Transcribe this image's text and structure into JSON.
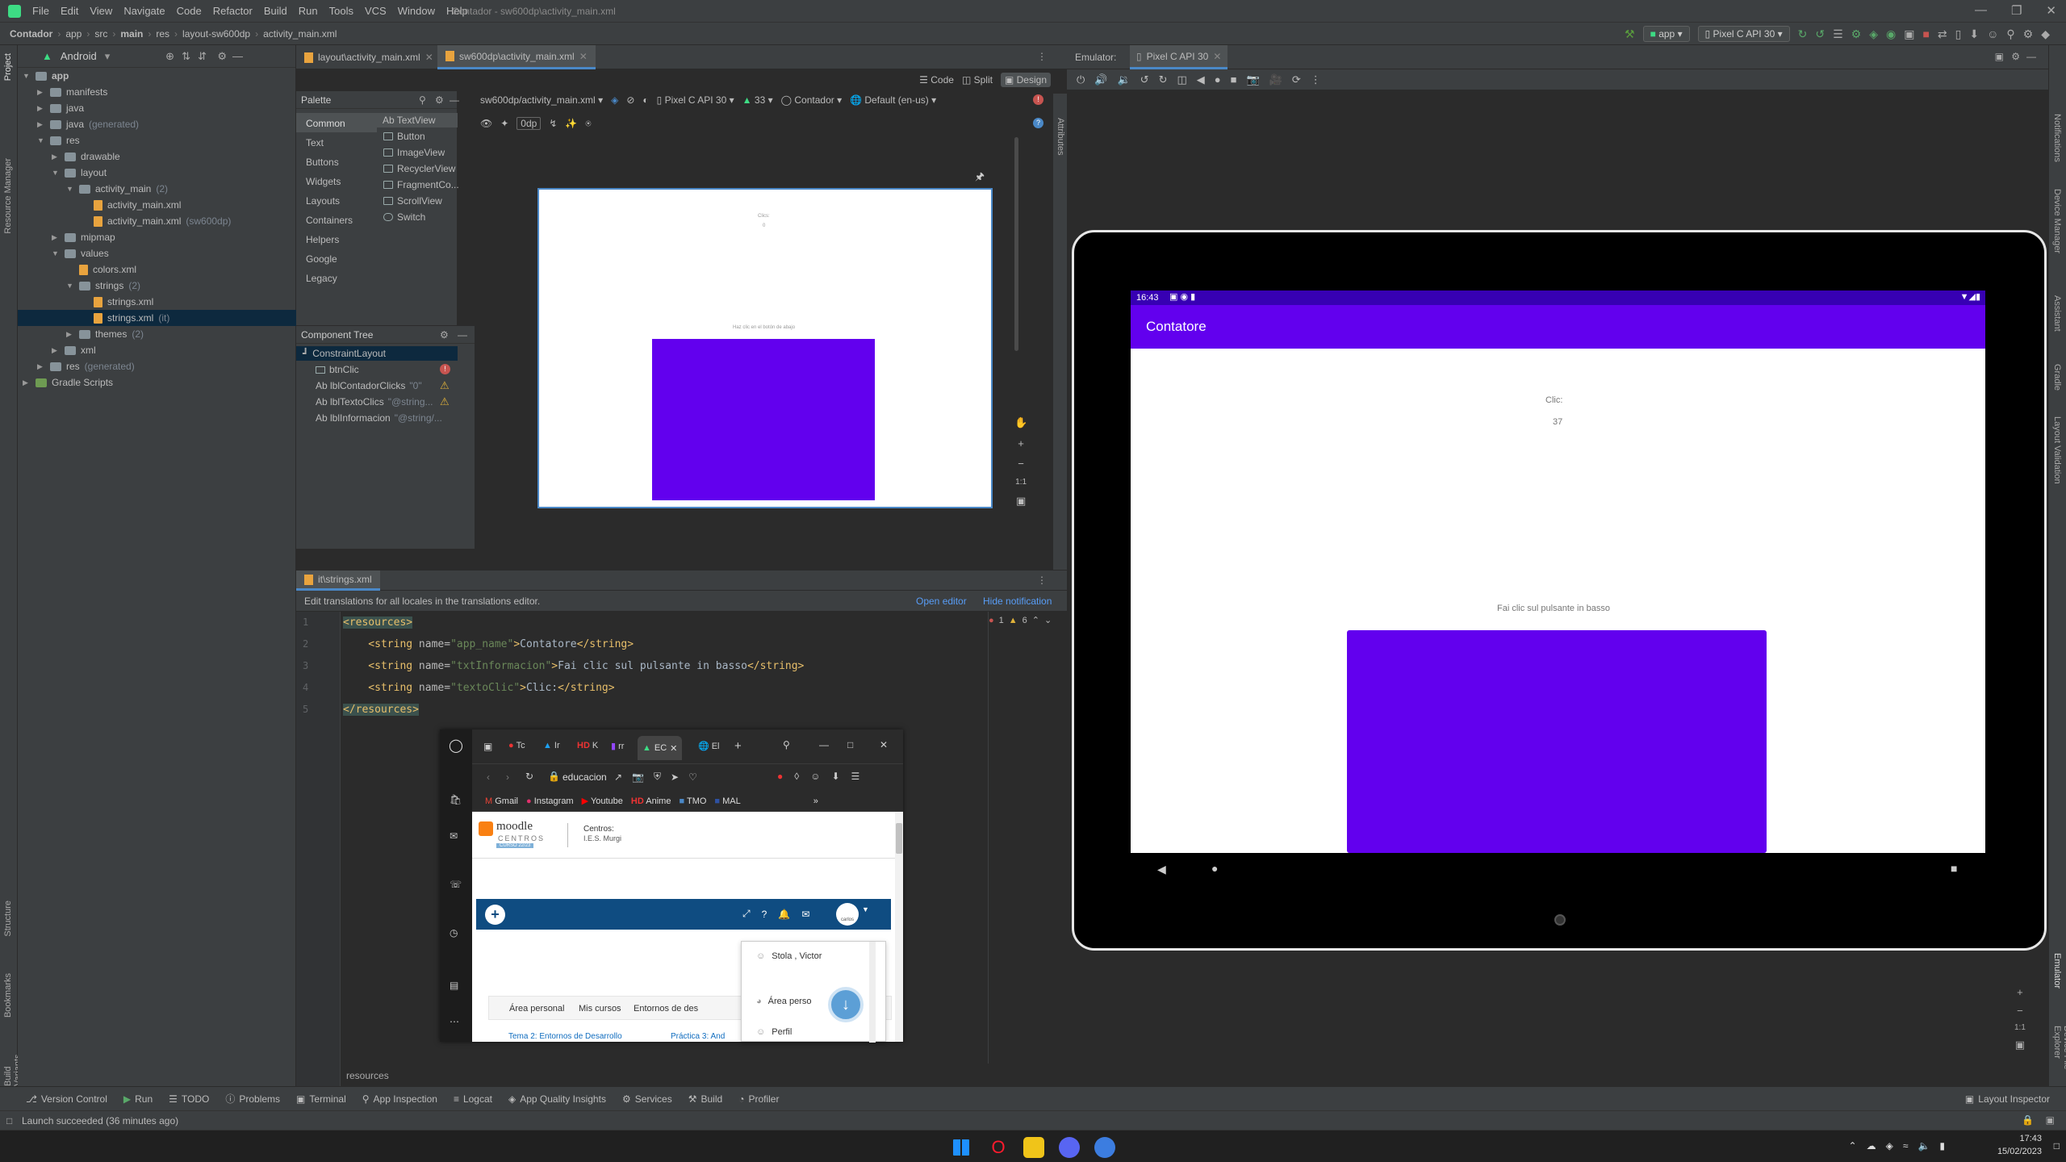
{
  "window": {
    "title": "Contador - sw600dp\\activity_main.xml",
    "menu": [
      "File",
      "Edit",
      "View",
      "Navigate",
      "Code",
      "Refactor",
      "Build",
      "Run",
      "Tools",
      "VCS",
      "Window",
      "Help"
    ]
  },
  "breadcrumb": [
    "Contador",
    "app",
    "src",
    "main",
    "res",
    "layout-sw600dp",
    "activity_main.xml"
  ],
  "run": {
    "config": "app",
    "device": "Pixel C API 30"
  },
  "project": {
    "view_mode": "Android",
    "items": [
      {
        "label": "app",
        "depth": 0,
        "expanded": true
      },
      {
        "label": "manifests",
        "depth": 1
      },
      {
        "label": "java",
        "depth": 1
      },
      {
        "label": "java",
        "suffix": "(generated)",
        "depth": 1
      },
      {
        "label": "res",
        "depth": 1,
        "expanded": true
      },
      {
        "label": "drawable",
        "depth": 2
      },
      {
        "label": "layout",
        "depth": 2,
        "expanded": true
      },
      {
        "label": "activity_main",
        "suffix": "(2)",
        "depth": 3,
        "expanded": true
      },
      {
        "label": "activity_main.xml",
        "depth": 4,
        "file": true
      },
      {
        "label": "activity_main.xml",
        "suffix": "(sw600dp)",
        "depth": 4,
        "file": true
      },
      {
        "label": "mipmap",
        "depth": 2
      },
      {
        "label": "values",
        "depth": 2,
        "expanded": true
      },
      {
        "label": "colors.xml",
        "depth": 3,
        "file": true
      },
      {
        "label": "strings",
        "suffix": "(2)",
        "depth": 3,
        "expanded": true
      },
      {
        "label": "strings.xml",
        "depth": 4,
        "file": true
      },
      {
        "label": "strings.xml",
        "suffix": "(it)",
        "depth": 4,
        "file": true,
        "selected": true
      },
      {
        "label": "themes",
        "suffix": "(2)",
        "depth": 3
      },
      {
        "label": "xml",
        "depth": 2
      },
      {
        "label": "res",
        "suffix": "(generated)",
        "depth": 1
      },
      {
        "label": "Gradle Scripts",
        "depth": 0
      }
    ]
  },
  "editor_tabs": [
    {
      "label": "layout\\activity_main.xml"
    },
    {
      "label": "sw600dp\\activity_main.xml",
      "active": true
    }
  ],
  "design": {
    "modes": [
      "Code",
      "Split",
      "Design"
    ],
    "file_select": "sw600dp/activity_main.xml",
    "device": "Pixel C API 30",
    "api": "33",
    "theme": "Contador",
    "locale": "Default (en-us)",
    "margin": "0dp",
    "palette_title": "Palette",
    "palette_categories": [
      "Common",
      "Text",
      "Buttons",
      "Widgets",
      "Layouts",
      "Containers",
      "Helpers",
      "Google",
      "Legacy"
    ],
    "palette_items": [
      "Ab TextView",
      "Button",
      "ImageView",
      "RecyclerView",
      "FragmentCo...",
      "ScrollView",
      "Switch"
    ],
    "component_tree_title": "Component Tree",
    "components": [
      {
        "label": "ConstraintLayout",
        "depth": 0
      },
      {
        "label": "btnClic",
        "depth": 1,
        "status": "error"
      },
      {
        "label": "Ab lblContadorClicks",
        "hint": "\"0\"",
        "depth": 1,
        "status": "warn"
      },
      {
        "label": "Ab lblTextoClics",
        "hint": "\"@string...",
        "depth": 1,
        "status": "warn"
      },
      {
        "label": "Ab lblInformacion",
        "hint": "\"@string/...",
        "depth": 1
      }
    ],
    "preview_label1": "Clics:",
    "preview_label2": "0",
    "preview_info": "Haz clic en el botón de abajo",
    "zoom_ratio": "1:1"
  },
  "strings_editor": {
    "tab": "it\\strings.xml",
    "notification": "Edit translations for all locales in the translations editor.",
    "open_editor": "Open editor",
    "hide_notification": "Hide notification",
    "errors": "1",
    "warnings": "6",
    "lines": [
      {
        "n": "1",
        "parts": [
          {
            "t": "<resources>",
            "c": "tag"
          }
        ]
      },
      {
        "n": "2",
        "parts": [
          {
            "t": "    <string ",
            "c": "tag"
          },
          {
            "t": "name=",
            "c": "attr"
          },
          {
            "t": "\"app_name\"",
            "c": "val"
          },
          {
            "t": ">",
            "c": "tag"
          },
          {
            "t": "Contatore",
            "c": "txt"
          },
          {
            "t": "</string>",
            "c": "tag"
          }
        ]
      },
      {
        "n": "3",
        "parts": [
          {
            "t": "    <string ",
            "c": "tag"
          },
          {
            "t": "name=",
            "c": "attr"
          },
          {
            "t": "\"txtInformacion\"",
            "c": "val"
          },
          {
            "t": ">",
            "c": "tag"
          },
          {
            "t": "Fai clic sul pulsante in basso",
            "c": "txt"
          },
          {
            "t": "</string>",
            "c": "tag"
          }
        ]
      },
      {
        "n": "4",
        "parts": [
          {
            "t": "    <string ",
            "c": "tag"
          },
          {
            "t": "name=",
            "c": "attr"
          },
          {
            "t": "\"textoClic\"",
            "c": "val"
          },
          {
            "t": ">",
            "c": "tag"
          },
          {
            "t": "Clic:",
            "c": "txt"
          },
          {
            "t": "</string>",
            "c": "tag"
          }
        ]
      },
      {
        "n": "5",
        "parts": [
          {
            "t": "</resources>",
            "c": "tag"
          }
        ]
      }
    ],
    "footer": "resources"
  },
  "emulator": {
    "label": "Emulator:",
    "tab": "Pixel C API 30",
    "time": "16:43",
    "app_title": "Contatore",
    "click_label": "Clic:",
    "click_count": "37",
    "info": "Fai clic sul pulsante in basso",
    "zoom_ratio": "1:1"
  },
  "browser": {
    "tabs": [
      "Tc",
      "Ir",
      "K",
      "rr",
      "EC",
      "El"
    ],
    "address": "educacion",
    "bookmarks": [
      "Gmail",
      "Instagram",
      "Youtube",
      "Anime",
      "TMO",
      "MAL"
    ],
    "moodle_logo": "moodle",
    "moodle_sub": "CENTROS",
    "moodle_year": "CURSO 22/23",
    "centros_title": "Centros:",
    "centros_sub": "I.E.S. Murgi",
    "nav_tabs": [
      "Área personal",
      "Mis cursos",
      "Entornos de des"
    ],
    "breadcrumb": [
      "Tema 2: Entornos de Desarrollo",
      "Práctica 3: And"
    ],
    "dropdown": [
      "Stola , Victor",
      "Área perso",
      "Perfil"
    ],
    "avatar_label": "carlos"
  },
  "right_tools": [
    "Notifications",
    "Device Manager",
    "Assistant",
    "Gradle",
    "Layout Validation",
    "Emulator",
    "Device File Explorer"
  ],
  "left_tools": [
    "Project",
    "Resource Manager",
    "Structure",
    "Bookmarks",
    "Build Variants"
  ],
  "tool_windows": [
    "Version Control",
    "Run",
    "TODO",
    "Problems",
    "Terminal",
    "App Inspection",
    "Logcat",
    "App Quality Insights",
    "Services",
    "Build",
    "Profiler"
  ],
  "layout_inspector": "Layout Inspector",
  "status": "Launch succeeded (36 minutes ago)",
  "clock": {
    "time": "17:43",
    "date": "15/02/2023"
  },
  "colors": {
    "purple": "#6200ee",
    "purple_dark": "#3700b3",
    "ide_bg": "#2b2b2b",
    "panel": "#3c3f41",
    "accent": "#4a88c7"
  }
}
